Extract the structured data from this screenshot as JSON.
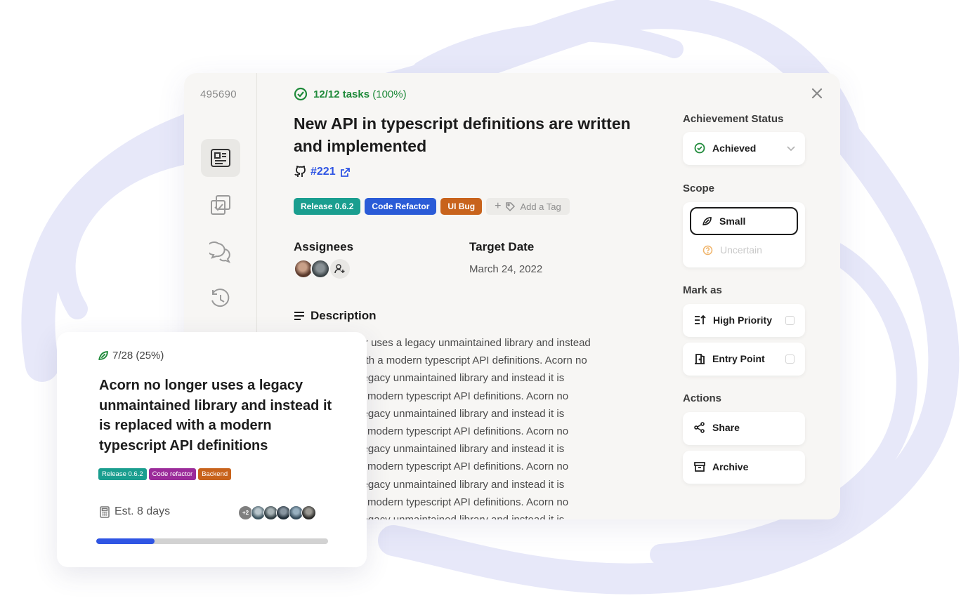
{
  "modal": {
    "issue_id": "495690",
    "tasks_count": "12/12 tasks",
    "tasks_percent": "(100%)",
    "title": "New API in typescript definitions are written and implemented",
    "github_ref": "#221",
    "tags": [
      {
        "label": "Release 0.6.2",
        "color": "#1a9e8f"
      },
      {
        "label": "Code Refactor",
        "color": "#2a5bd7"
      },
      {
        "label": "UI Bug",
        "color": "#c8631c"
      }
    ],
    "add_tag_label": "Add a Tag",
    "assignees_label": "Assignees",
    "target_date_label": "Target Date",
    "target_date": "March 24, 2022",
    "description_label": "Description",
    "description_lines": [
      "Acorn no longer uses a legacy unmaintained library and instead",
      "it is replaced with a modern typescript API definitions. Acorn no",
      "longer uses a legacy unmaintained library and instead it is",
      "replaced with a modern typescript API definitions. Acorn no",
      "longer uses a legacy unmaintained library and instead it is",
      "replaced with a modern typescript API definitions. Acorn no",
      "longer uses a legacy unmaintained library and instead it is",
      "replaced with a modern typescript API definitions. Acorn no",
      "longer uses a legacy unmaintained library and instead it is",
      "replaced with a modern typescript API definitions. Acorn no",
      "longer uses a legacy unmaintained library and instead it is"
    ]
  },
  "side": {
    "achievement_label": "Achievement Status",
    "achievement_value": "Achieved",
    "scope_label": "Scope",
    "scope_selected": "Small",
    "scope_other": "Uncertain",
    "mark_as_label": "Mark as",
    "high_priority": "High Priority",
    "entry_point": "Entry Point",
    "actions_label": "Actions",
    "share": "Share",
    "archive": "Archive"
  },
  "card": {
    "progress": "7/28 (25%)",
    "progress_fraction": 0.25,
    "title": "Acorn no longer uses a legacy unmaintained library and instead it is replaced with a modern typescript API definitions",
    "tags": [
      {
        "label": "Release 0.6.2",
        "color": "#1a9e8f"
      },
      {
        "label": "Code refactor",
        "color": "#9b2b9a"
      },
      {
        "label": "Backend",
        "color": "#c8631c"
      }
    ],
    "estimate": "Est. 8 days",
    "more_assignees": "+2"
  },
  "colors": {
    "accent_blue": "#2f55e4",
    "success_green": "#1f8a3a"
  }
}
